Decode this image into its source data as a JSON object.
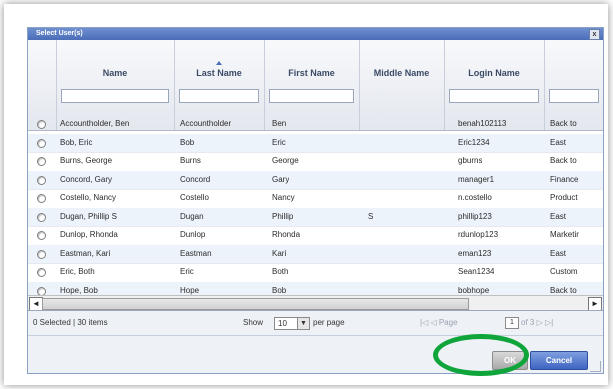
{
  "dialog": {
    "title": "Select User(s)",
    "close_label": "x"
  },
  "columns": [
    "Name",
    "Last Name",
    "First Name",
    "Middle Name",
    "Login Name",
    ""
  ],
  "sorted_column": "Last Name",
  "rows": [
    [
      "Accountholder, Ben",
      "Accountholder",
      "Ben",
      "",
      "benah102113",
      "Back to"
    ],
    [
      "Bob, Eric",
      "Bob",
      "Eric",
      "",
      "Eric1234",
      "East"
    ],
    [
      "Burns, George",
      "Burns",
      "George",
      "",
      "gburns",
      "Back to"
    ],
    [
      "Concord, Gary",
      "Concord",
      "Gary",
      "",
      "manager1",
      "Finance"
    ],
    [
      "Costello, Nancy",
      "Costello",
      "Nancy",
      "",
      "n.costello",
      "Product"
    ],
    [
      "Dugan, Phillip S",
      "Dugan",
      "Phillip",
      "S",
      "phillip123",
      "East"
    ],
    [
      "Dunlop, Rhonda",
      "Dunlop",
      "Rhonda",
      "",
      "rdunlop123",
      "Marketir"
    ],
    [
      "Eastman, Kari",
      "Eastman",
      "Kari",
      "",
      "eman123",
      "East"
    ],
    [
      "Eric, Both",
      "Eric",
      "Both",
      "",
      "Sean1234",
      "Custom"
    ],
    [
      "Hope, Bob",
      "Hope",
      "Bob",
      "",
      "bobhope",
      "Back to"
    ]
  ],
  "scroll": {
    "left_icon": "◄",
    "right_icon": "►"
  },
  "footer": {
    "selection_status": "0 Selected | 30 items",
    "show_label": "Show",
    "page_size": "10",
    "per_page_label": "per page",
    "pager_nav": "|◁ ◁ Page",
    "page_number": "1",
    "page_of": "of 3 ▷ ▷|"
  },
  "buttons": {
    "ok": "OK",
    "cancel": "Cancel"
  },
  "colors": {
    "title_bar": "#4a6db8",
    "annotation_circle": "#0fa53a",
    "cancel_button": "#3e64c2"
  }
}
